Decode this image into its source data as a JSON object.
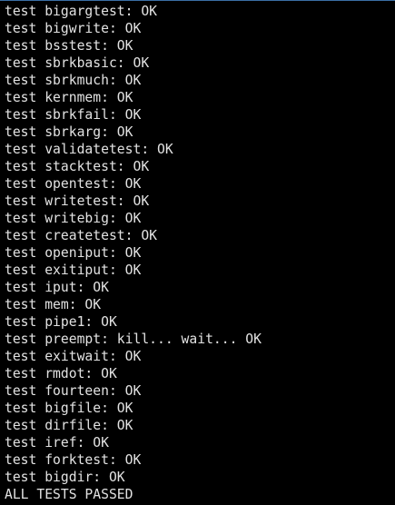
{
  "lines": [
    "test bigargtest: OK",
    "test bigwrite: OK",
    "test bsstest: OK",
    "test sbrkbasic: OK",
    "test sbrkmuch: OK",
    "test kernmem: OK",
    "test sbrkfail: OK",
    "test sbrkarg: OK",
    "test validatetest: OK",
    "test stacktest: OK",
    "test opentest: OK",
    "test writetest: OK",
    "test writebig: OK",
    "test createtest: OK",
    "test openiput: OK",
    "test exitiput: OK",
    "test iput: OK",
    "test mem: OK",
    "test pipe1: OK",
    "test preempt: kill... wait... OK",
    "test exitwait: OK",
    "test rmdot: OK",
    "test fourteen: OK",
    "test bigfile: OK",
    "test dirfile: OK",
    "test iref: OK",
    "test forktest: OK",
    "test bigdir: OK",
    "ALL TESTS PASSED"
  ]
}
